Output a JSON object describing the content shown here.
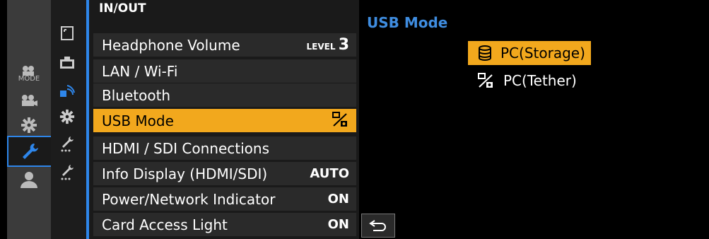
{
  "tabs": [
    "MODE",
    "video",
    "custom",
    "setup",
    "my-menu"
  ],
  "menu": {
    "title": "IN/OUT",
    "items": [
      {
        "label": "Headphone Volume",
        "value_prefix": "LEVEL",
        "value": "3"
      },
      {
        "label": "LAN / Wi-Fi",
        "value": ""
      },
      {
        "label": "Bluetooth",
        "value": ""
      },
      {
        "label": "USB Mode",
        "value": "",
        "selected": true
      },
      {
        "label": "HDMI / SDI Connections",
        "value": ""
      },
      {
        "label": "Info Display (HDMI/SDI)",
        "value": "AUTO"
      },
      {
        "label": "Power/Network Indicator",
        "value": "ON"
      },
      {
        "label": "Card Access Light",
        "value": "ON"
      }
    ]
  },
  "pane": {
    "title": "USB Mode",
    "options": [
      {
        "label": "PC(Storage)",
        "icon": "storage-icon",
        "selected": true
      },
      {
        "label": "PC(Tether)",
        "icon": "tether-icon",
        "selected": false
      }
    ]
  },
  "colors": {
    "accent": "#2e86ea",
    "highlight": "#f2a81d",
    "title_blue": "#3f8de0"
  }
}
